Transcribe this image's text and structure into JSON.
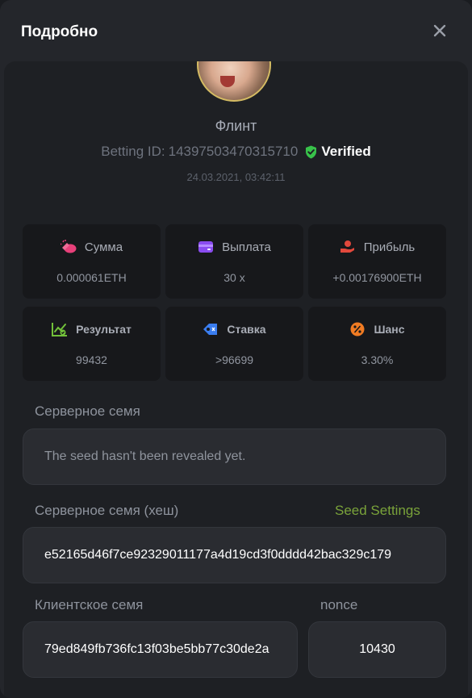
{
  "modal": {
    "title": "Подробно",
    "close_icon": "close-icon"
  },
  "bet": {
    "username": "Флинт",
    "betting_id_label": "Betting ID:",
    "betting_id": "14397503470315710",
    "verified_label": "Verified",
    "timestamp": "24.03.2021, 03:42:11"
  },
  "stats": [
    {
      "label": "Сумма",
      "value": "0.000061ETH",
      "icon": "coins-icon",
      "color": "#e8407a"
    },
    {
      "label": "Выплата",
      "value": "30 x",
      "icon": "wallet-icon",
      "color": "#8a4cf0"
    },
    {
      "label": "Прибыль",
      "value": "+0.00176900ETH",
      "icon": "hand-coin-icon",
      "color": "#e1483c"
    },
    {
      "label": "Результат",
      "value": "99432",
      "icon": "chart-check-icon",
      "color": "#72c13a"
    },
    {
      "label": "Ставка",
      "value": ">96699",
      "icon": "ticket-icon",
      "color": "#3a7df0"
    },
    {
      "label": "Шанс",
      "value": "3.30%",
      "icon": "percent-icon",
      "color": "#f07b23"
    }
  ],
  "seeds": {
    "server_seed_label": "Серверное семя",
    "server_seed_value": "The seed hasn't been revealed yet.",
    "server_hash_label": "Серверное семя (хеш)",
    "seed_settings_link": "Seed Settings",
    "server_hash_value": "e52165d46f7ce92329011177a4d19cd3f0dddd42bac329c179",
    "client_seed_label": "Клиентское семя",
    "client_seed_value": "79ed849fb736fc13f03be5bb77c30de2a",
    "nonce_label": "nonce",
    "nonce_value": "10430"
  }
}
